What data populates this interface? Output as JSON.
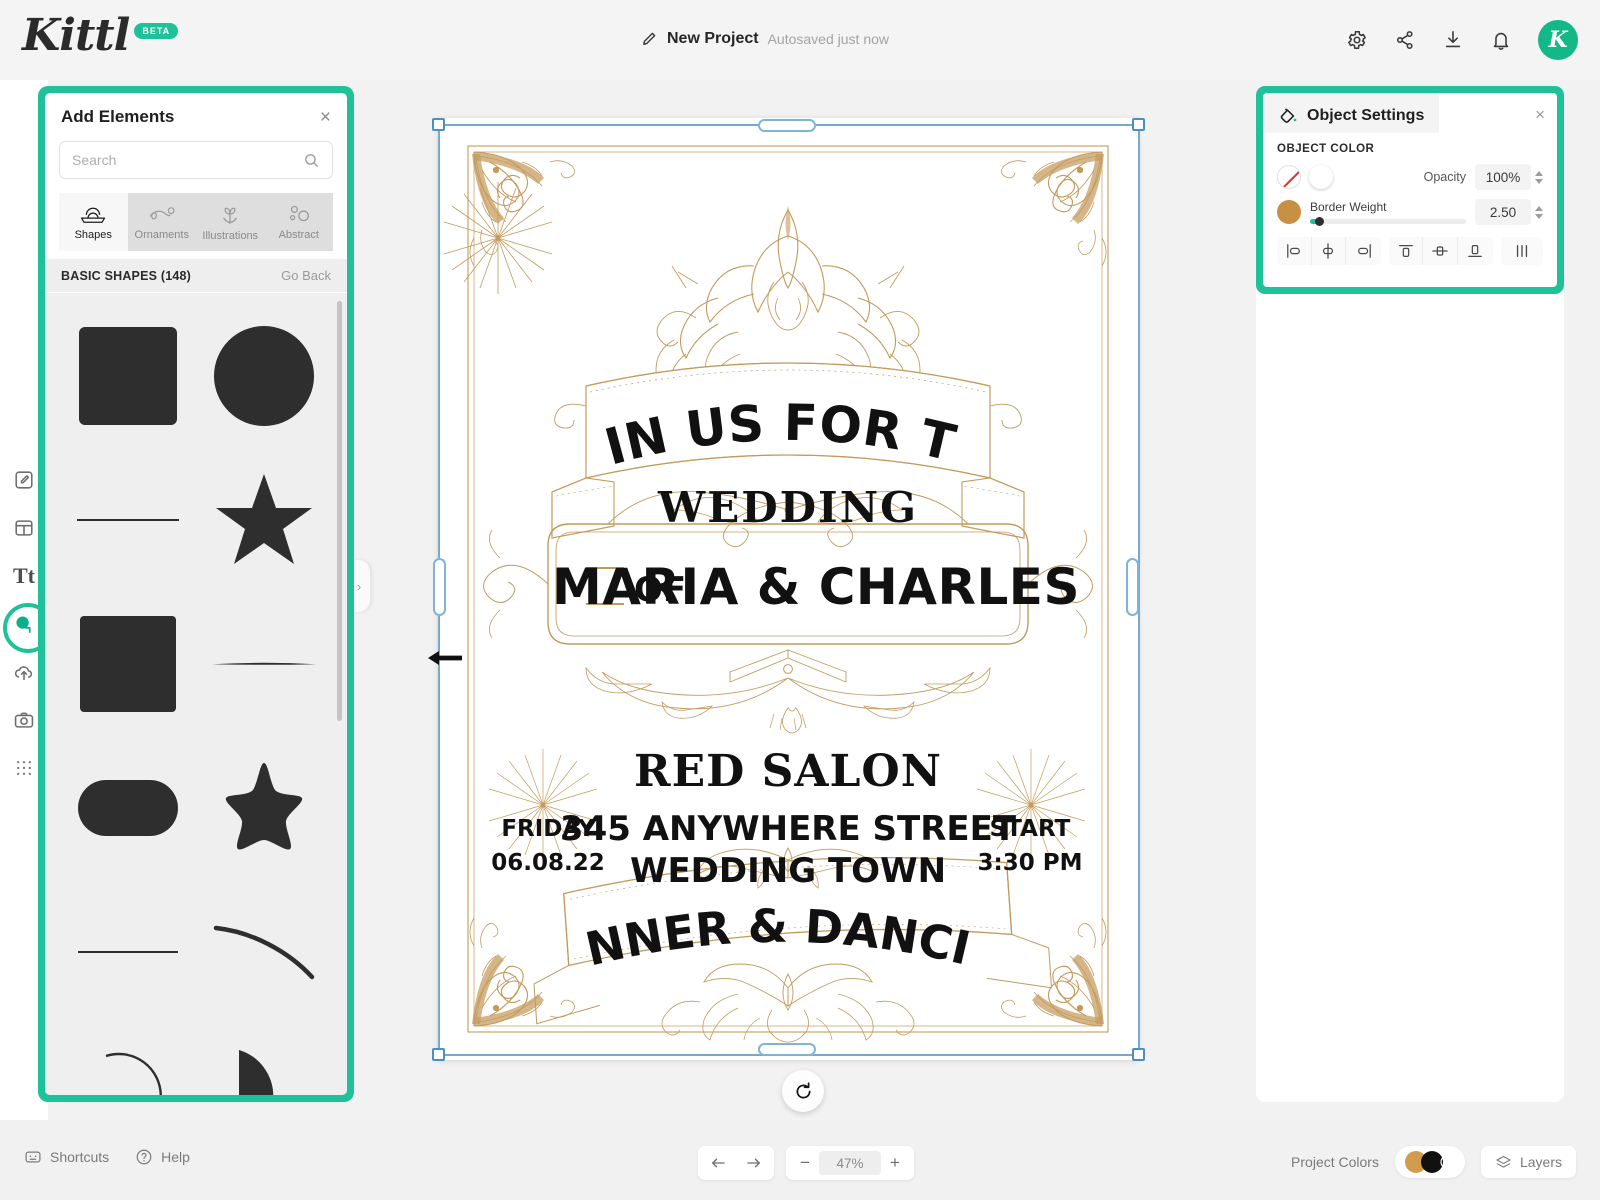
{
  "app": {
    "logo": "Kittl",
    "beta_badge": "BETA",
    "accent_color": "#1ec198",
    "avatar_initial": "K"
  },
  "topbar": {
    "project_name": "New Project",
    "autosave_status": "Autosaved just now",
    "icons": [
      "pencil-icon",
      "gear-icon",
      "share-icon",
      "download-icon",
      "bell-icon"
    ]
  },
  "rail": {
    "items": [
      {
        "name": "edit",
        "icon": "pencil-square-icon",
        "active": false
      },
      {
        "name": "templates",
        "icon": "layout-icon",
        "active": false
      },
      {
        "name": "text",
        "icon": "text-tt-icon",
        "active": false
      },
      {
        "name": "elements",
        "icon": "elements-icon",
        "active": true
      },
      {
        "name": "uploads",
        "icon": "upload-cloud-icon",
        "active": false
      },
      {
        "name": "photos",
        "icon": "camera-icon",
        "active": false
      },
      {
        "name": "patterns",
        "icon": "grid-dots-icon",
        "active": false
      }
    ]
  },
  "elements_panel": {
    "title": "Add Elements",
    "close_label": "×",
    "search_placeholder": "Search",
    "search_value": "",
    "tabs": [
      {
        "label": "Shapes",
        "icon": "shapes-icon",
        "active": true
      },
      {
        "label": "Ornaments",
        "icon": "ornaments-icon",
        "active": false
      },
      {
        "label": "Illustrations",
        "icon": "illustrations-icon",
        "active": false
      },
      {
        "label": "Abstract",
        "icon": "abstract-icon",
        "active": false
      }
    ],
    "section_title": "BASIC SHAPES (148)",
    "go_back_label": "Go Back",
    "shapes": [
      "rounded-square",
      "circle",
      "line-straight",
      "star-5-point",
      "rounded-square-2",
      "line-tapered",
      "pill-stadium",
      "star-rounded",
      "line-thin",
      "arc-curve",
      "circle-arc-outline",
      "half-moon"
    ]
  },
  "object_settings": {
    "title": "Object Settings",
    "icon": "paint-bucket-icon",
    "close_label": "×",
    "object_color_label": "OBJECT COLOR",
    "fill_none_swatch": "no-fill",
    "fill_white_swatch": "#ffffff",
    "border_color_swatch": "#c89043",
    "opacity_label": "Opacity",
    "opacity_value": "100%",
    "border_weight_label": "Border Weight",
    "border_weight_value": "2.50",
    "align_buttons": [
      "align-left-icon",
      "align-center-horizontal-icon",
      "align-right-icon",
      "align-top-icon",
      "align-middle-vertical-icon",
      "align-bottom-icon",
      "distribute-icon"
    ]
  },
  "canvas": {
    "rotate_handle": "rotate-icon",
    "cursor": "drag-arrow-left",
    "poster": {
      "line_join": "JOIN US FOR THE",
      "line_wedding": "WEDDING",
      "line_of": "OF",
      "line_names": "MARIA & CHARLES",
      "venue": "RED SALON",
      "address_1": "345 ANYWHERE STREET",
      "address_2": "WEDDING TOWN",
      "day_label": "FRIDAY",
      "day_value": "06.08.22",
      "start_label": "START",
      "start_value": "3:30 PM",
      "footer_banner": "DINNER & DANCING",
      "ornament_color": "#c49a5c",
      "text_color": "#111111"
    }
  },
  "bottombar": {
    "shortcuts_label": "Shortcuts",
    "help_label": "Help",
    "undo_icon": "undo-arrow-icon",
    "redo_icon": "redo-arrow-icon",
    "zoom_out_label": "−",
    "zoom_value": "47%",
    "zoom_in_label": "+",
    "project_colors_label": "Project Colors",
    "project_colors": [
      "#d19c4e",
      "#111111"
    ],
    "layers_label": "Layers"
  }
}
